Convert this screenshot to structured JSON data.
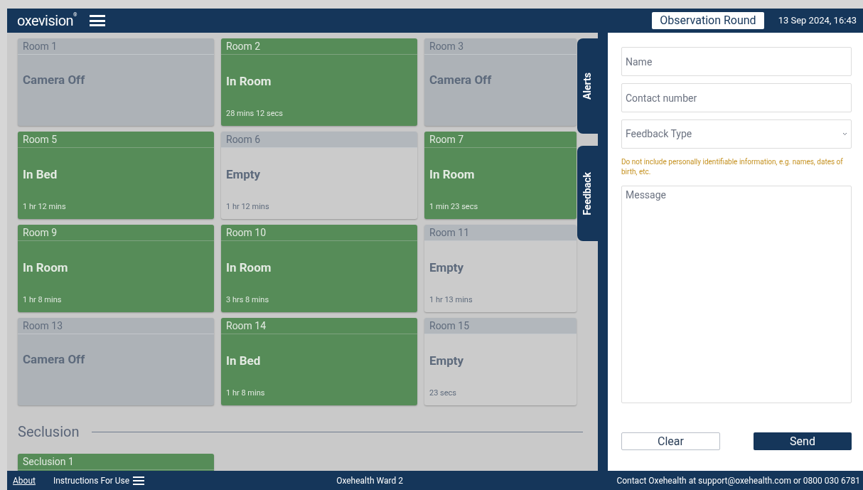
{
  "header": {
    "logo": "oxevision$^{®}$",
    "round_button": "Observation Round",
    "datetime": "13 Sep 2024, 16:43"
  },
  "rooms": [
    {
      "name": "Room 1",
      "kind": "camera-off",
      "status": "Camera Off"
    },
    {
      "name": "Room 2",
      "kind": "occupied",
      "status": "In Room",
      "duration": "28 mins 12 secs"
    },
    {
      "name": "Room 3",
      "kind": "camera-off",
      "status": "Camera Off"
    },
    {
      "name": "Room 5",
      "kind": "occupied",
      "status": "In Bed",
      "duration": "1 hr 12 mins"
    },
    {
      "name": "Room 6",
      "kind": "empty",
      "status": "Empty",
      "duration": "1 hr 12 mins"
    },
    {
      "name": "Room 7",
      "kind": "occupied",
      "status": "In Room",
      "duration": "1 min 23 secs"
    },
    {
      "name": "Room 9",
      "kind": "occupied",
      "status": "In Room",
      "duration": "1 hr 8 mins"
    },
    {
      "name": "Room 10",
      "kind": "occupied",
      "status": "In Room",
      "duration": "3 hrs 8 mins"
    },
    {
      "name": "Room 11",
      "kind": "empty",
      "status": "Empty",
      "duration": "1 hr 13 mins"
    },
    {
      "name": "Room 13",
      "kind": "camera-off",
      "status": "Camera Off"
    },
    {
      "name": "Room 14",
      "kind": "occupied",
      "status": "In Bed",
      "duration": "1 hr 8 mins"
    },
    {
      "name": "Room 15",
      "kind": "empty",
      "status": "Empty",
      "duration": "23 secs"
    }
  ],
  "seclusion": {
    "title": "Seclusion",
    "rooms": [
      {
        "name": "Seclusion 1",
        "kind": "occupied"
      }
    ]
  },
  "side_tabs": [
    "Alerts",
    "Feedback"
  ],
  "feedback_form": {
    "name_placeholder": "Name",
    "contact_placeholder": "Contact number",
    "type_placeholder": "Feedback Type",
    "warning": "Do not include personally identifiable information, e.g. names, dates of birth, etc.",
    "message_placeholder": "Message",
    "clear_button": "Clear",
    "send_button": "Send"
  },
  "footer": {
    "about": "About",
    "instructions": "Instructions For Use",
    "ward": "Oxehealth Ward 2",
    "contact": "Contact Oxehealth at support@oxehealth.com or 0800 030 6781"
  }
}
